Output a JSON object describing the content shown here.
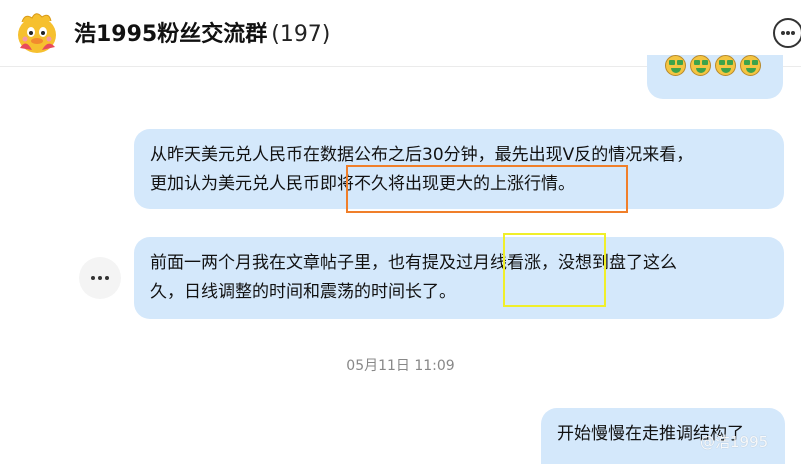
{
  "header": {
    "title": "浩1995粉丝交流群",
    "member_count": "(197)"
  },
  "messages": [
    {
      "line1": "从昨天美元兑人民币在数据公布之后30分钟，最先出现V反的情况来看，",
      "line2": "更加认为美元兑人民币即将不久将出现更大的上涨行情。"
    },
    {
      "line1": "前面一两个月我在文章帖子里，也有提及过月线看涨，没想到盘了这么",
      "line2": "久，日线调整的时间和震荡的时间长了。"
    }
  ],
  "timestamp": "05月11日 11:09",
  "last_message": "开始慢慢在走推调结构了",
  "watermark": "@浩1995",
  "colors": {
    "bubble": "#d4e8fb",
    "highlight_orange": "#f07f2a",
    "highlight_yellow": "#f0ef2a"
  }
}
